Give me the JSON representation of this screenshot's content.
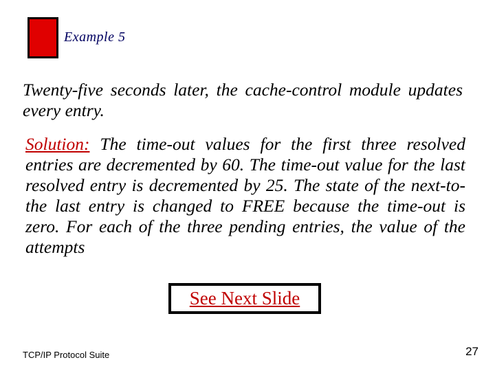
{
  "header": {
    "example_label": "Example 5"
  },
  "prompt": "Twenty-five seconds later, the cache-control module updates every entry.",
  "solution": {
    "label": "Solution:",
    "body": " The time-out values for the first three resolved entries are decremented by 60. The time-out value for the last resolved entry is decremented by 25. The state of the next-to-the last entry is changed to FREE because the time-out is zero. For each of the three pending entries, the value of the attempts"
  },
  "see_next": "See Next Slide",
  "footer": {
    "left": "TCP/IP Protocol Suite",
    "page_number": "27"
  }
}
